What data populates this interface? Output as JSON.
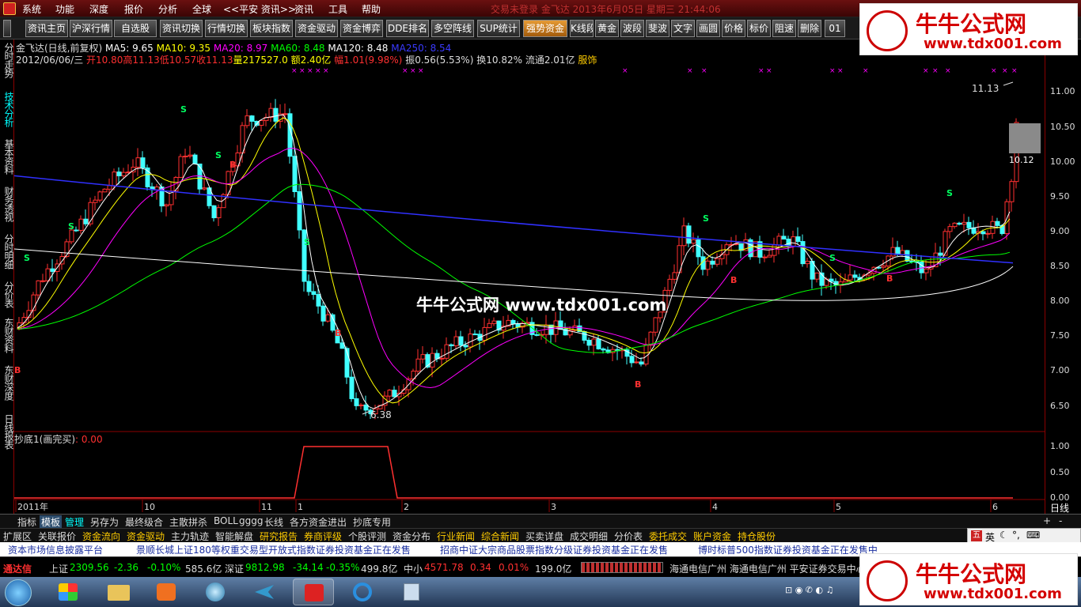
{
  "menubar": {
    "items": [
      "系统",
      "功能",
      "深度",
      "报价",
      "分析",
      "全球",
      "<<平安 资讯>>",
      "资讯",
      "工具",
      "帮助"
    ],
    "marquee": "交易未登录  金飞达  2013年6月05日  星期三  21:44:06"
  },
  "toolbar": {
    "buttons": [
      "资讯主页",
      "沪深行情",
      "自选股",
      "资讯切换",
      "行情切换",
      "板块指数",
      "资金驱动",
      "资金博弈",
      "DDE排名",
      "多空阵线",
      "SUP统计",
      "强势资金",
      "K线段",
      "黄金",
      "波段",
      "斐波",
      "文字",
      "画圆",
      "价格",
      "标价",
      "阻速",
      "删除",
      "01"
    ]
  },
  "left_tabs": [
    "分时走势",
    "技术分析",
    "基本资料",
    "财务透视",
    "分时明细",
    "分价表",
    "东财资料",
    "东财深度",
    "日线报表"
  ],
  "chart_header": {
    "line1": {
      "name": "金飞达(日线,前复权)",
      "ma5": "MA5: 9.65",
      "ma10": "MA10: 9.35",
      "ma20": "MA20: 8.97",
      "ma60": "MA60: 8.48",
      "ma120": "MA120: 8.48",
      "ma250": "MA250: 8.54"
    },
    "line2": {
      "date": "2012/06/06/三",
      "open": "开10.80",
      "high": "高11.13",
      "low": "低10.57",
      "close": "收11.13",
      "volume": "量217527.0",
      "amount": "额2.40亿",
      "change": "幅1.01(9.98%)",
      "amplitude": "振0.56(5.53%)",
      "turnover": "换10.82%",
      "float": "流通2.01亿",
      "industry": "服饰"
    },
    "high_label": "11.13",
    "low_label": "6.38",
    "price_flag": "10.12"
  },
  "y_axis_labels": [
    "11.00",
    "10.50",
    "10.00",
    "9.50",
    "9.00",
    "8.50",
    "8.00",
    "7.50",
    "7.00",
    "6.50"
  ],
  "indicator": {
    "title": "抄底1(画完买)",
    "value": ": 0.00",
    "ticks": [
      "1.00",
      "0.50",
      "0.00"
    ]
  },
  "time_axis": {
    "labels": [
      "2011年",
      "10",
      "11",
      "1",
      "2",
      "3",
      "4",
      "5",
      "6"
    ],
    "period": "日线",
    "plus": "+",
    "minus": "-"
  },
  "bottom_tabs1": [
    "指标",
    "模板",
    "管理",
    "另存为",
    "最终级合",
    "主散拼杀",
    "BOLL",
    "gggg",
    "长线",
    "各方资金进出",
    "抄底专用"
  ],
  "bottom_tabs2": [
    "扩展区",
    "关联报价",
    "资金流向",
    "资金驱动",
    "主力轨迹",
    "智能解盘",
    "研究报告",
    "券商评级",
    "个股评测",
    "资金分布",
    "行业新闻",
    "综合新闻",
    "买卖详盘",
    "成交明细",
    "分价表",
    "委托成交",
    "账户资金",
    "持仓股份"
  ],
  "news": [
    "资本市场信息披露平台",
    "景顺长城上证180等权重交易型开放式指数证券投资基金正在发售",
    "招商中证大宗商品股票指数分级证券投资基金正在发售",
    "博时标普500指数证券投资基金正在发售中"
  ],
  "status": {
    "brand": "通达信",
    "sh_name": "上证",
    "sh_value": "2309.56",
    "sh_change": "-2.36",
    "sh_pct": "-0.10%",
    "sh_amount": "585.6亿",
    "sz_name": "深证",
    "sz_value": "9812.98",
    "sz_change": "-34.14",
    "sz_pct": "-0.35%",
    "sz_amount": "499.8亿",
    "zx_name": "中小",
    "zx_value": "4571.78",
    "zx_change": "0.34",
    "zx_pct": "0.01%",
    "zx_amount": "199.0亿",
    "servers": "海通电信广州  海通电信广州  平安证券交易中心"
  },
  "ime": {
    "label": "英"
  },
  "watermarks": {
    "center": "牛牛公式网 www.tdx001.com",
    "logo_title": "牛牛公式网",
    "logo_url": "www.tdx001.com"
  },
  "chart_data": {
    "type": "candlestick",
    "ylim": [
      6.2,
      11.3
    ],
    "x_labels": [
      "2011年",
      "10",
      "11",
      "1",
      "2",
      "3",
      "4",
      "5",
      "6"
    ],
    "series": [
      {
        "name": "MA5",
        "color": "#ffffff"
      },
      {
        "name": "MA10",
        "color": "#ffff00"
      },
      {
        "name": "MA20",
        "color": "#ff00ff"
      },
      {
        "name": "MA60",
        "color": "#00ff00"
      },
      {
        "name": "MA120",
        "color": "#ffffff"
      },
      {
        "name": "MA250",
        "color": "#3030ff"
      }
    ],
    "high": 11.13,
    "low": 6.38,
    "last_close": 11.13
  },
  "colors": {
    "up": "#ff3030",
    "down": "#40ffff",
    "ma250": "#3030ff",
    "ma60": "#00ff00",
    "ma20": "#ff00ff",
    "ma10": "#ffff00",
    "ma5": "#ffffff"
  }
}
